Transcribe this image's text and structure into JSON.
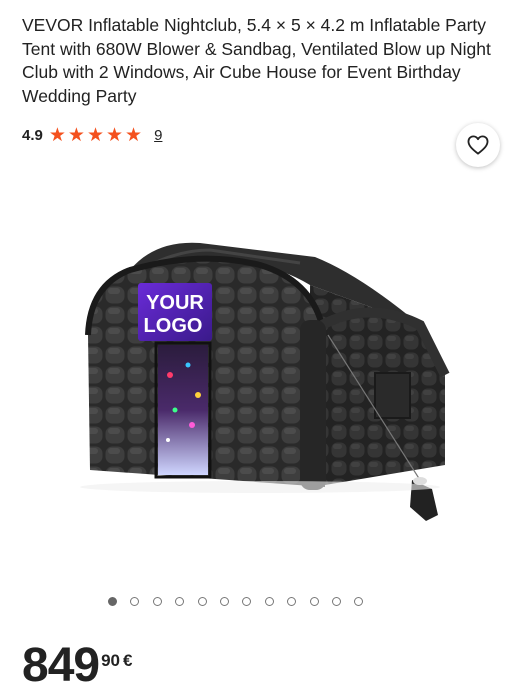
{
  "product": {
    "title": "VEVOR Inflatable Nightclub, 5.4 × 5 × 4.2 m Inflatable Party Tent with 680W Blower & Sandbag, Ventilated Blow up Night Club with 2 Windows, Air Cube House for Event Birthday Wedding Party",
    "rating": {
      "value": "4.9",
      "stars": 5,
      "count": "9",
      "star_color": "#f4511e"
    },
    "image": {
      "logo_text_line1": "YOUR",
      "logo_text_line2": "LOGO"
    },
    "carousel": {
      "total": 12,
      "active_index": 0
    },
    "price": {
      "integer": "849",
      "decimals": "90",
      "currency": "€"
    }
  },
  "icons": {
    "wishlist": "heart-icon",
    "star": "star-icon"
  }
}
